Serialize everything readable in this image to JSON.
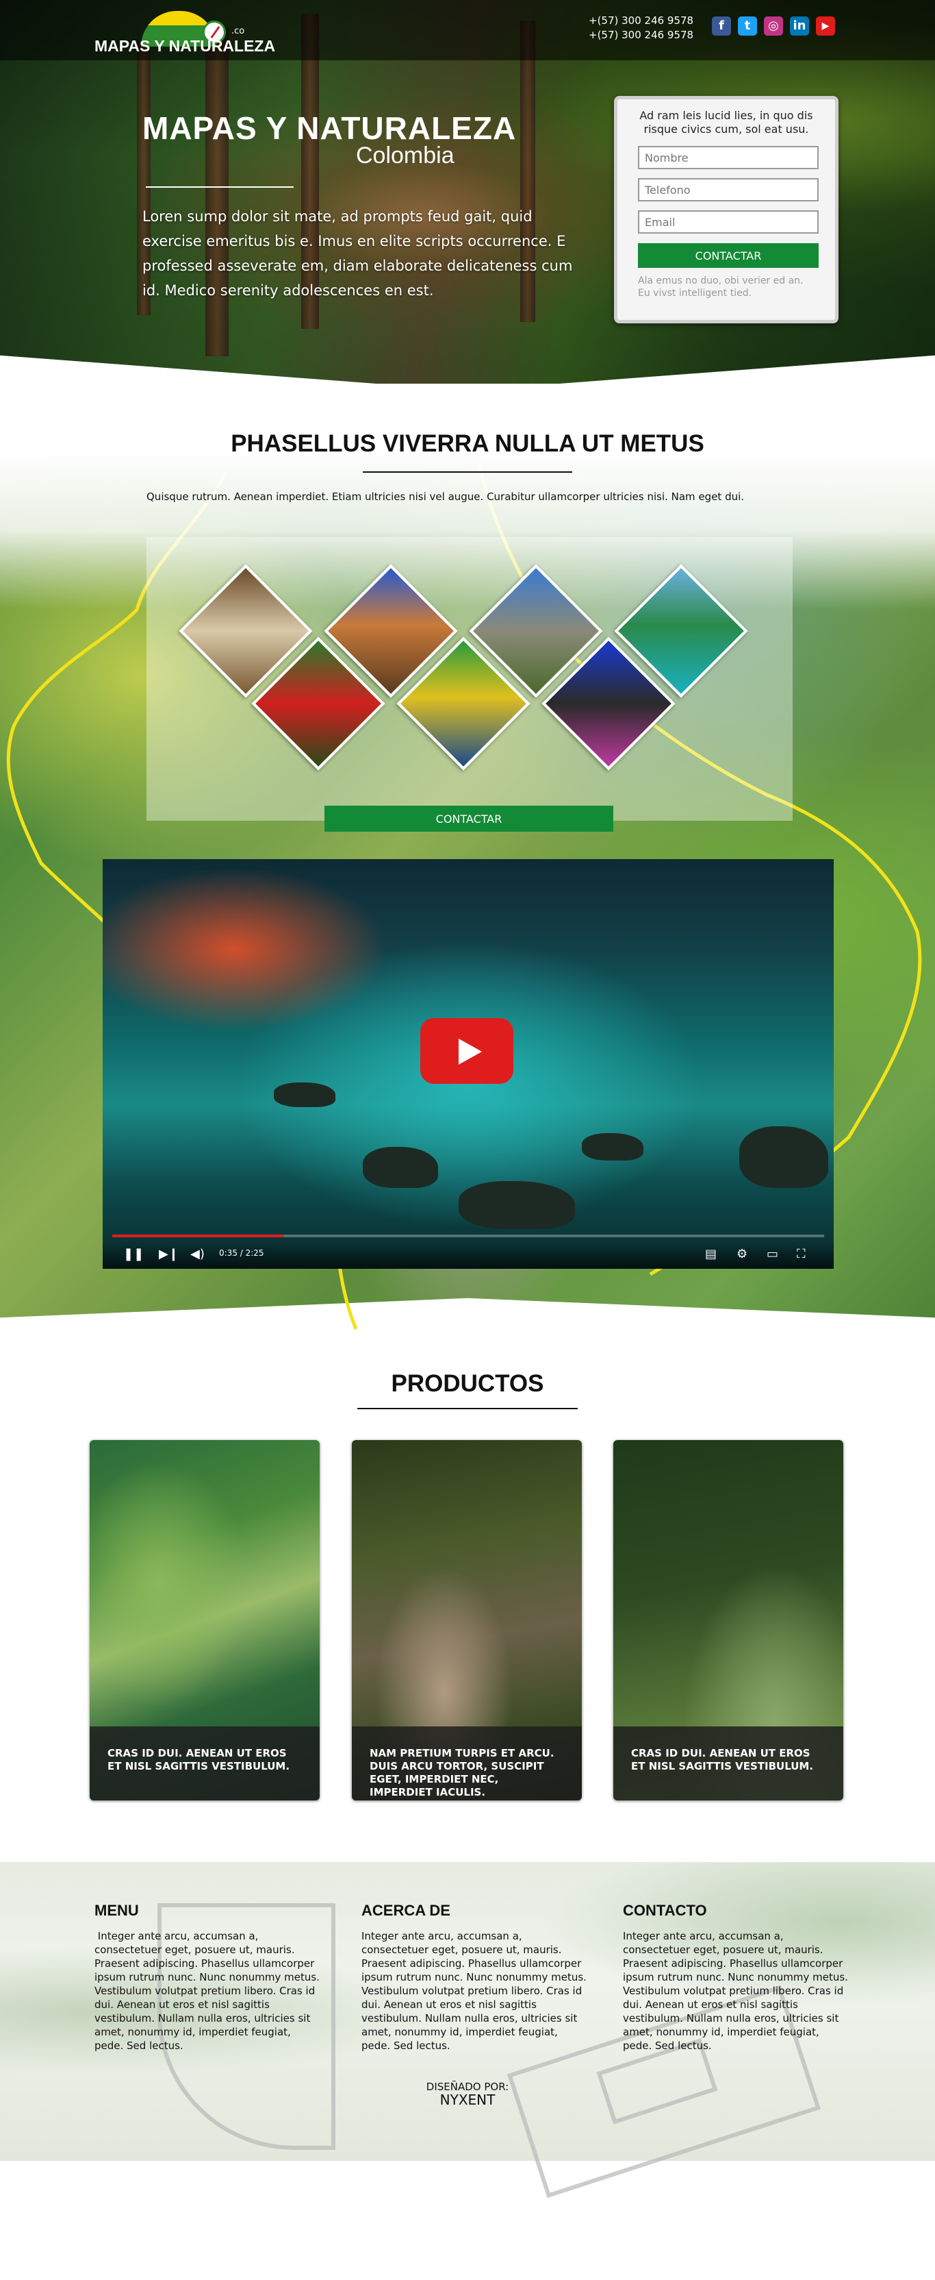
{
  "header": {
    "logo_text": "MAPAS Y NATURALEZA",
    "logo_suffix": ".co",
    "phones": [
      "+(57) 300 246 9578",
      "+(57) 300 246 9578"
    ],
    "social": [
      {
        "icon": "facebook-icon",
        "glyph": "f",
        "color": "#3b5998"
      },
      {
        "icon": "twitter-icon",
        "glyph": "t",
        "color": "#1da1f2"
      },
      {
        "icon": "instagram-icon",
        "glyph": "◎",
        "color": "#c13584"
      },
      {
        "icon": "linkedin-icon",
        "glyph": "in",
        "color": "#0077b5"
      },
      {
        "icon": "youtube-icon",
        "glyph": "▶",
        "color": "#e01d1d"
      }
    ]
  },
  "hero": {
    "title": "MAPAS Y NATURALEZA",
    "subtitle": "Colombia",
    "text": "Loren sump dolor sit mate, ad prompts feud gait, quid exercise emeritus bis e. Imus en elite scripts occurrence. E professed asseverate em, diam elaborate delicateness cum id. Medico serenity adolescences en est."
  },
  "form": {
    "heading": "Ad ram leis lucid lies, in quo dis risque civics cum, sol eat usu.",
    "fields": [
      {
        "placeholder": "Nombre"
      },
      {
        "placeholder": "Telefono"
      },
      {
        "placeholder": "Email"
      }
    ],
    "button": "CONTACTAR",
    "footnote": "Ala emus no duo, obi verier ed an. Eu vivst intelligent tied."
  },
  "map_section": {
    "title": "PHASELLUS VIVERRA NULLA UT METUS",
    "description": "Quisque rutrum. Aenean imperdiet. Etiam ultricies nisi vel augue. Curabitur ullamcorper ultricies nisi. Nam eget dui.",
    "cta": "CONTACTAR",
    "gallery": [
      "indigenous-people-photo",
      "horseback-rider-photo",
      "el-penol-rock-photo",
      "island-resort-photo",
      "macaw-parrots-photo",
      "chiva-bus-photo",
      "hiker-mountain-photo"
    ]
  },
  "video": {
    "time": "0:35 / 2:25",
    "progress": 0.24
  },
  "products": {
    "title": "PRODUCTOS",
    "items": [
      {
        "caption": "CRAS ID DUI. AENEAN UT EROS ET NISL SAGITTIS VESTIBULUM."
      },
      {
        "caption": "NAM PRETIUM TURPIS ET ARCU. DUIS ARCU TORTOR, SUSCIPIT EGET, IMPERDIET NEC, IMPERDIET IACULIS."
      },
      {
        "caption": "CRAS ID DUI. AENEAN UT EROS ET NISL SAGITTIS VESTIBULUM."
      }
    ]
  },
  "footer": {
    "columns": [
      {
        "heading": "MENU",
        "body": " Integer ante arcu, accumsan a, consectetuer eget, posuere ut, mauris. Praesent adipiscing. Phasellus ullamcorper ipsum rutrum nunc. Nunc nonummy metus. Vestibulum volutpat pretium libero. Cras id dui. Aenean ut eros et nisl sagittis vestibulum. Nullam nulla eros, ultricies sit amet, nonummy id, imperdiet feugiat, pede. Sed lectus."
      },
      {
        "heading": "ACERCA DE",
        "body": "Integer ante arcu, accumsan a, consectetuer eget, posuere ut, mauris. Praesent adipiscing. Phasellus ullamcorper ipsum rutrum nunc. Nunc nonummy metus. Vestibulum volutpat pretium libero. Cras id dui. Aenean ut eros et nisl sagittis vestibulum. Nullam nulla eros, ultricies sit amet, nonummy id, imperdiet feugiat, pede. Sed lectus."
      },
      {
        "heading": "CONTACTO",
        "body": "Integer ante arcu, accumsan a, consectetuer eget, posuere ut, mauris. Praesent adipiscing. Phasellus ullamcorper ipsum rutrum nunc. Nunc nonummy metus. Vestibulum volutpat pretium libero. Cras id dui. Aenean ut eros et nisl sagittis vestibulum. Nullam nulla eros, ultricies sit amet, nonummy id, imperdiet feugiat, pede. Sed lectus."
      }
    ],
    "credit_label": "DISEÑADO POR:",
    "credit_name": "NYXENT"
  },
  "colors": {
    "accent_green": "#138a36",
    "youtube_red": "#e01d1d",
    "border_yellow": "#f2e21a"
  }
}
